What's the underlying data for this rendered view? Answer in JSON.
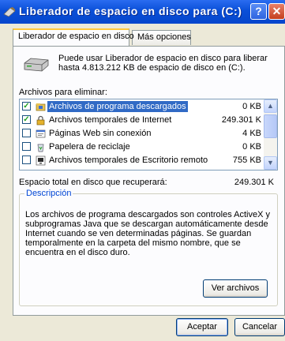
{
  "window": {
    "title": "Liberador de espacio en disco para  (C:)",
    "help_label": "?",
    "close_label": "✕"
  },
  "tabs": [
    {
      "label": "Liberador de espacio en disco",
      "active": true
    },
    {
      "label": "Más opciones",
      "active": false
    }
  ],
  "intro_text": "Puede usar Liberador de espacio en disco para liberar hasta 4.813.212 KB de espacio de disco en  (C:).",
  "files_label": "Archivos para eliminar:",
  "files": [
    {
      "name": "Archivos de programa descargados",
      "size": "0 KB",
      "checked": true,
      "selected": true,
      "icon": "folder-icon"
    },
    {
      "name": "Archivos temporales de Internet",
      "size": "249.301 K",
      "checked": true,
      "selected": false,
      "icon": "lock-icon"
    },
    {
      "name": "Páginas Web sin conexión",
      "size": "4 KB",
      "checked": false,
      "selected": false,
      "icon": "webpage-icon"
    },
    {
      "name": "Papelera de reciclaje",
      "size": "0 KB",
      "checked": false,
      "selected": false,
      "icon": "recycle-bin-icon"
    },
    {
      "name": "Archivos temporales de Escritorio remoto",
      "size": "755 KB",
      "checked": false,
      "selected": false,
      "icon": "remote-desktop-icon"
    }
  ],
  "total_label": "Espacio total en disco que recuperará:",
  "total_value": "249.301 K",
  "description": {
    "legend": "Descripción",
    "text": "Los archivos de programa descargados son controles ActiveX y subprogramas Java que se descargan automáticamente desde Internet cuando se ven determinadas páginas. Se guardan temporalmente en la carpeta del mismo nombre, que se encuentra en el disco duro."
  },
  "buttons": {
    "view_files": "Ver archivos",
    "ok": "Aceptar",
    "cancel": "Cancelar"
  },
  "colors": {
    "titlebar": "#0a4fd8",
    "selection": "#316ac5",
    "legend": "#0046d5"
  }
}
